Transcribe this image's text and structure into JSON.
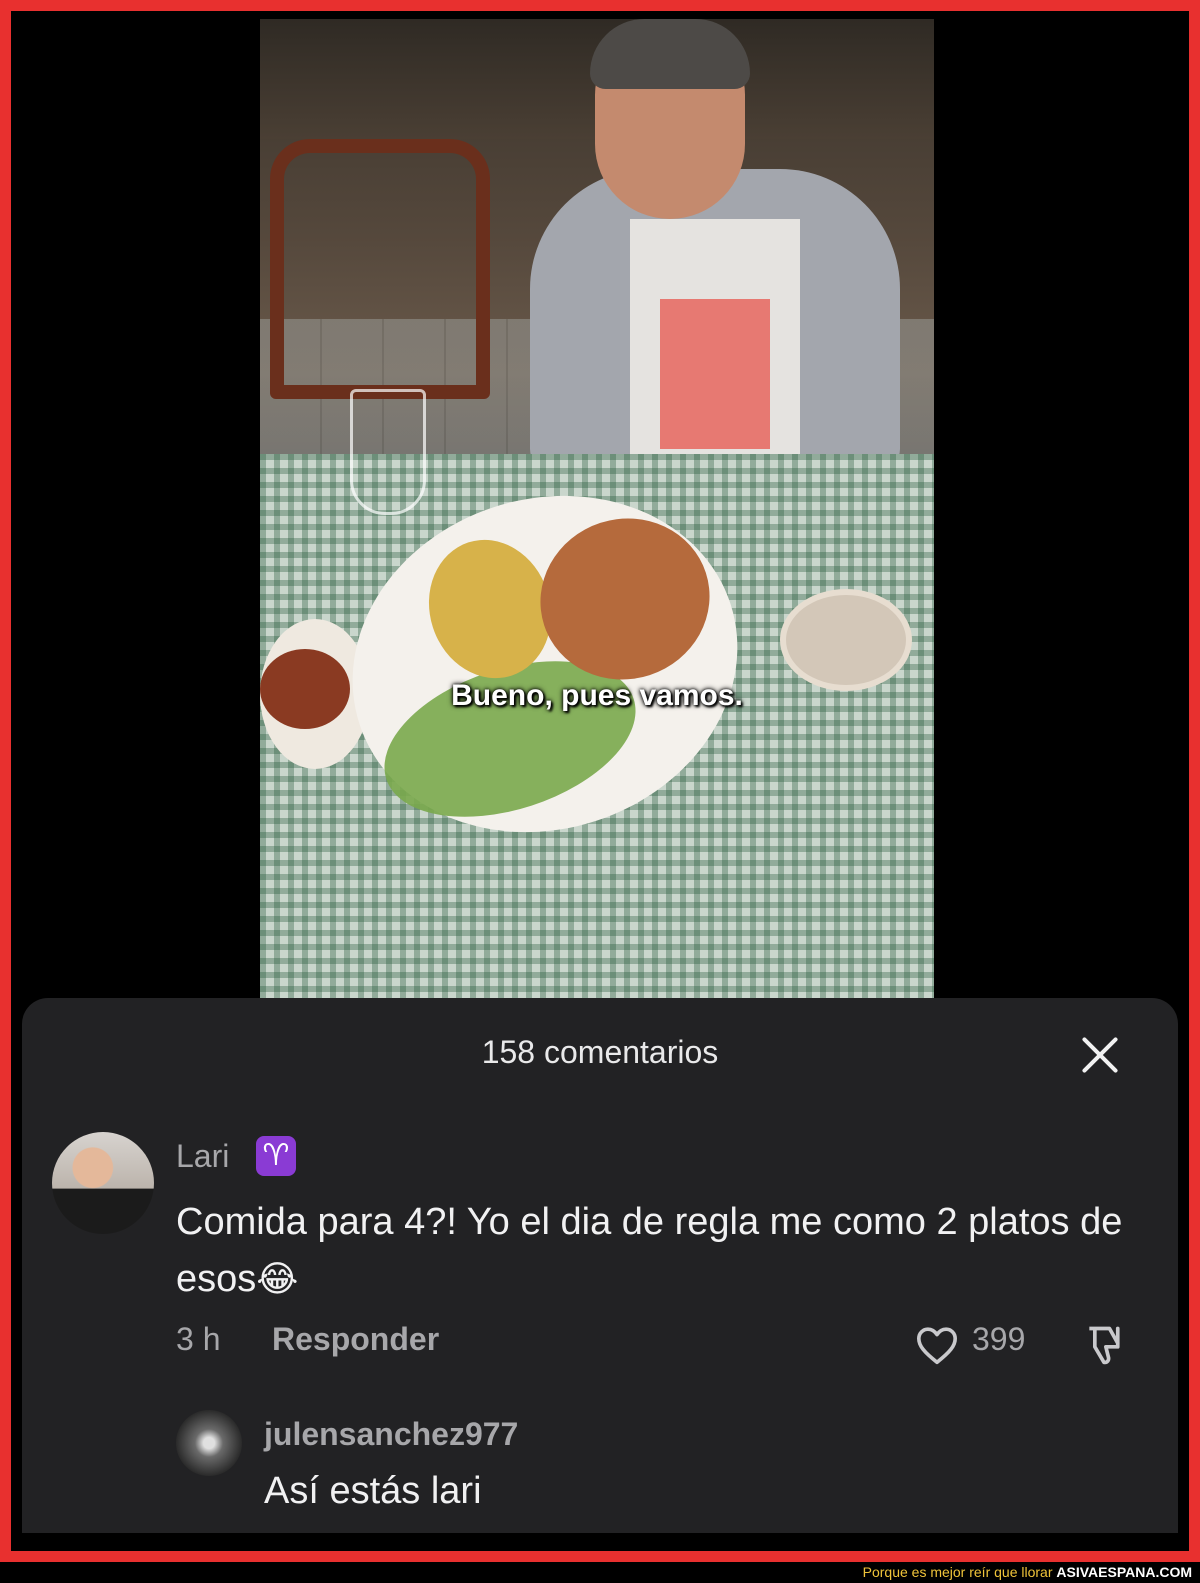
{
  "video": {
    "subtitle": "Bueno, pues vamos."
  },
  "comments_sheet": {
    "count_label": "158 comentarios",
    "comments": [
      {
        "username": "Lari",
        "badge_icon": "aries-icon",
        "text": "Comida para 4?! Yo el dia de regla me como 2 platos de esos",
        "emoji": "😂",
        "time": "3 h",
        "reply_label": "Responder",
        "likes": "399"
      },
      {
        "username": "julensanchez977",
        "text": "Así estás lari"
      }
    ]
  },
  "footer": {
    "tagline": "Porque es mejor reír que llorar",
    "site": "ASIVAESPANA.COM"
  },
  "colors": {
    "frame_border": "#e8302f",
    "sheet_background": "#222224",
    "badge": "#8a3bd4",
    "footer_tagline": "#f0c43a"
  }
}
